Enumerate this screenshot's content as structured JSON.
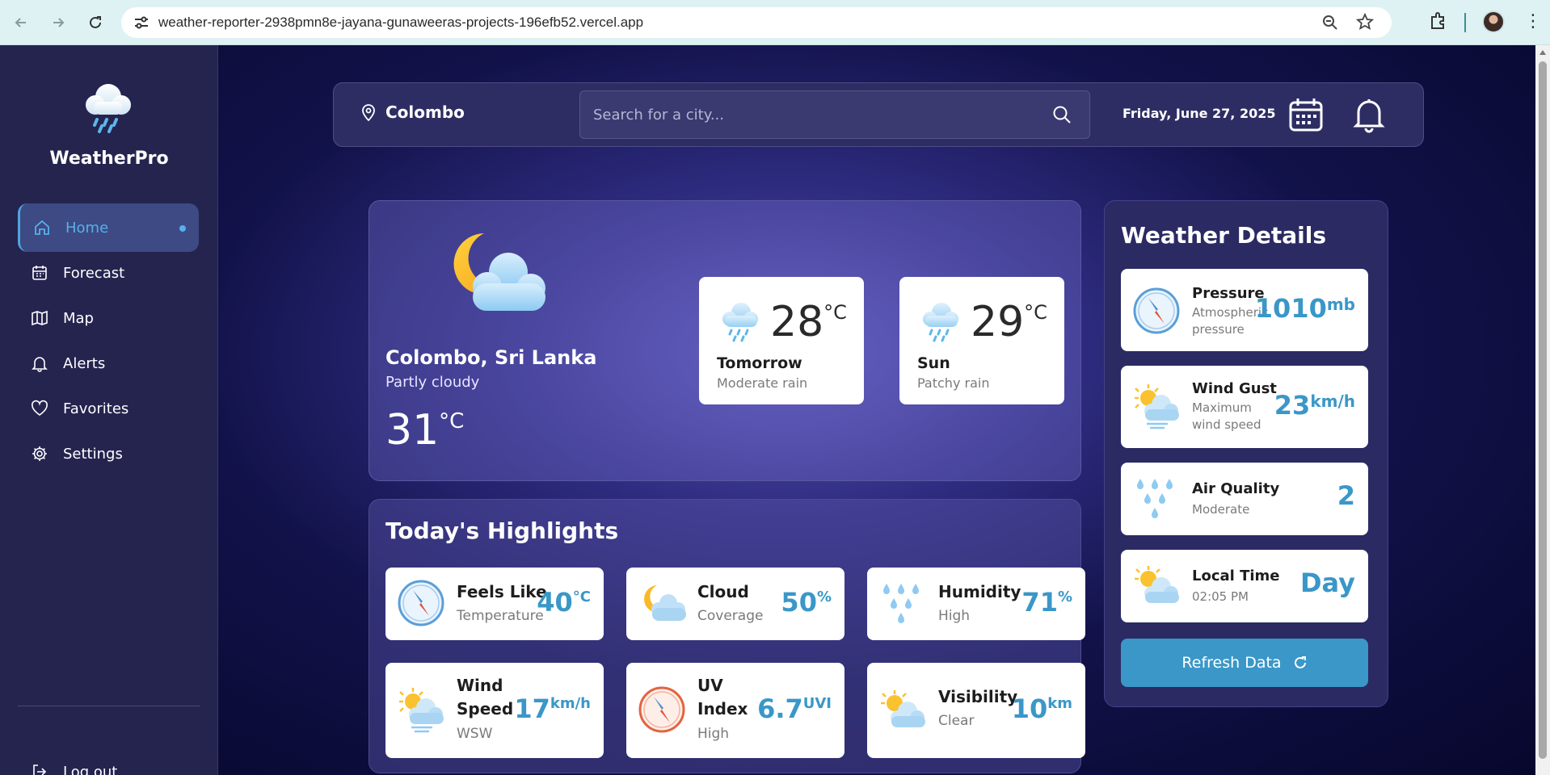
{
  "browser": {
    "url": "weather-reporter-2938pmn8e-jayana-gunaweeras-projects-196efb52.vercel.app",
    "icons": [
      "back-icon",
      "forward-icon",
      "reload-icon",
      "site-settings-icon",
      "zoom-icon",
      "bookmark-star-icon",
      "extensions-icon",
      "profile-avatar",
      "menu-icon"
    ]
  },
  "sidebar": {
    "brand": "WeatherPro",
    "items": [
      {
        "label": "Home",
        "icon": "home-icon",
        "active": true
      },
      {
        "label": "Forecast",
        "icon": "calendar-icon"
      },
      {
        "label": "Map",
        "icon": "map-icon"
      },
      {
        "label": "Alerts",
        "icon": "bell-icon"
      },
      {
        "label": "Favorites",
        "icon": "heart-icon"
      },
      {
        "label": "Settings",
        "icon": "gear-icon"
      }
    ],
    "logout": "Log out"
  },
  "topbar": {
    "location": "Colombo",
    "search_placeholder": "Search for a city...",
    "date": "Friday, June 27, 2025"
  },
  "current": {
    "city": "Colombo, Sri Lanka",
    "condition": "Partly cloudy",
    "temp": "31",
    "unit": "°C",
    "forecast": [
      {
        "day": "Tomorrow",
        "temp": "28",
        "unit": "°C",
        "condition": "Moderate rain",
        "icon": "rain-cloud-icon"
      },
      {
        "day": "Sun",
        "temp": "29",
        "unit": "°C",
        "condition": "Patchy rain",
        "icon": "rain-cloud-icon"
      }
    ]
  },
  "highlights": {
    "title": "Today's Highlights",
    "items": [
      {
        "name": "Feels Like",
        "sub": "Temperature",
        "value": "40",
        "unit": "°C",
        "icon": "compass-icon"
      },
      {
        "name": "Cloud",
        "sub": "Coverage",
        "value": "50",
        "unit": "%",
        "icon": "moon-cloud-icon"
      },
      {
        "name": "Humidity",
        "sub": "High",
        "value": "71",
        "unit": "%",
        "icon": "raindrops-icon"
      },
      {
        "name": "Wind",
        "name2": "Speed",
        "sub": "WSW",
        "value": "17",
        "unit": "km/h",
        "icon": "sun-wind-cloud-icon"
      },
      {
        "name": "UV",
        "name2": "Index",
        "sub": "High",
        "value": "6.7",
        "unit": "UVI",
        "icon": "red-compass-icon"
      },
      {
        "name": "Visibility",
        "sub": "Clear",
        "value": "10",
        "unit": "km",
        "icon": "sun-cloud-icon"
      }
    ]
  },
  "details": {
    "title": "Weather Details",
    "items": [
      {
        "name": "Pressure",
        "sub": "Atmospheric pressure",
        "value": "1010",
        "unit": "mb",
        "icon": "compass-icon"
      },
      {
        "name": "Wind Gust",
        "sub": "Maximum wind speed",
        "value": "23",
        "unit": "km/h",
        "icon": "sun-wind-cloud-icon"
      },
      {
        "name": "Air Quality",
        "sub": "Moderate",
        "value": "2",
        "unit": "",
        "icon": "raindrops-icon"
      },
      {
        "name": "Local Time",
        "sub": "02:05 PM",
        "value": "Day",
        "unit": "",
        "icon": "sun-cloud-icon"
      }
    ],
    "refresh_label": "Refresh Data"
  },
  "colors": {
    "accent": "#3a97c8",
    "sidebar": "#25244f",
    "background": "#0b0b3a"
  }
}
